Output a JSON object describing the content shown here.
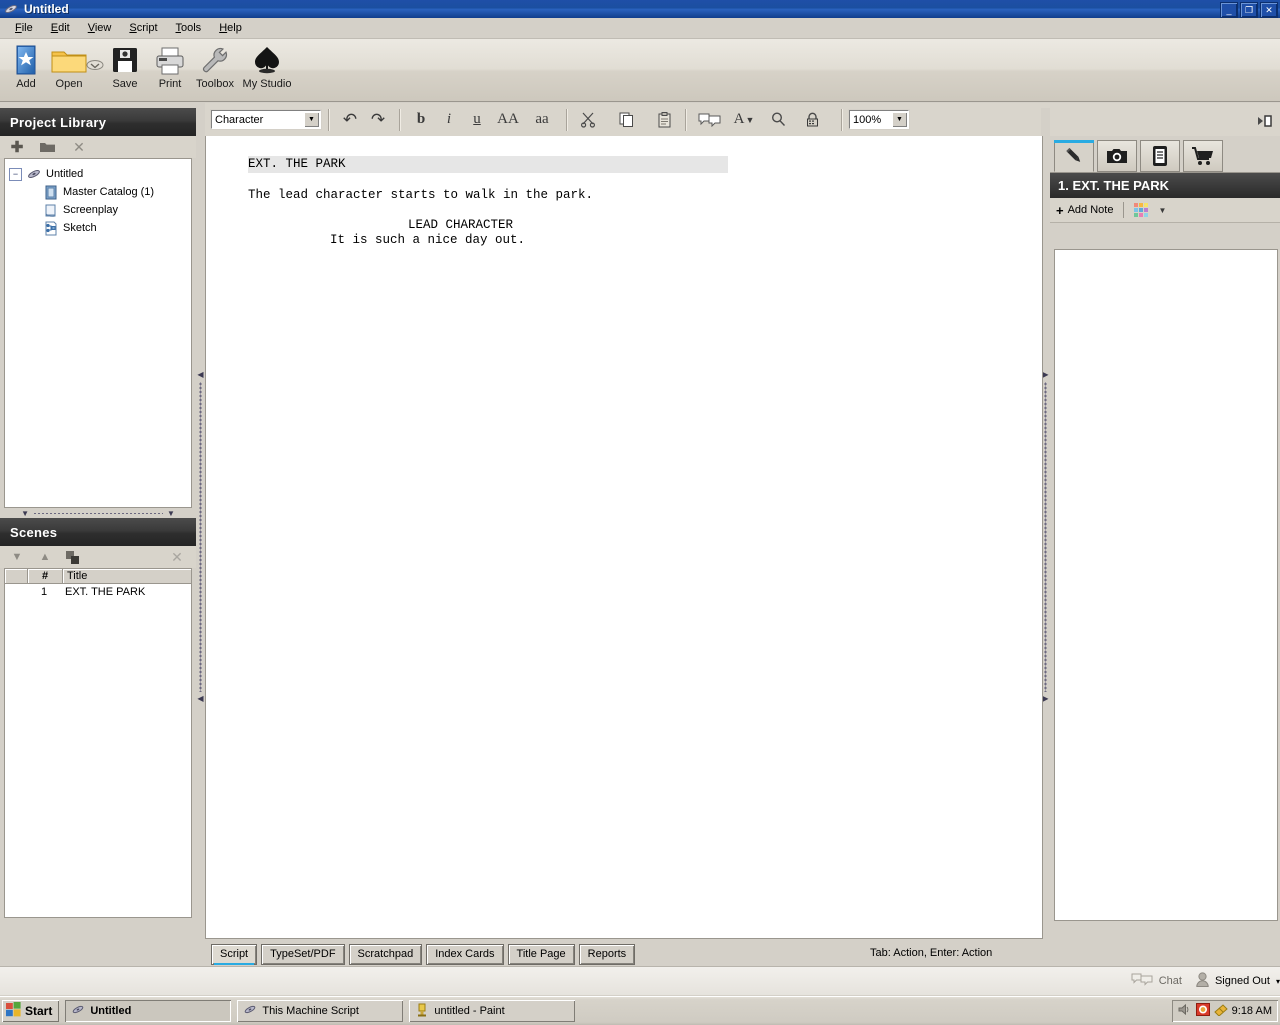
{
  "window": {
    "title": "Untitled",
    "icon": "app-logo-icon",
    "buttons": {
      "minimize": "_",
      "restore": "❐",
      "close": "✕"
    }
  },
  "menubar": [
    {
      "name": "file",
      "label": "File",
      "accel": "F"
    },
    {
      "name": "edit",
      "label": "Edit",
      "accel": "E"
    },
    {
      "name": "view",
      "label": "View",
      "accel": "V"
    },
    {
      "name": "script",
      "label": "Script",
      "accel": "S"
    },
    {
      "name": "tools",
      "label": "Tools",
      "accel": "T"
    },
    {
      "name": "help",
      "label": "Help",
      "accel": "H"
    }
  ],
  "maintoolbar": [
    {
      "name": "add",
      "label": "Add",
      "icon": "star-card-icon"
    },
    {
      "name": "open",
      "label": "Open",
      "icon": "folder-icon"
    },
    {
      "name": "save",
      "label": "Save",
      "icon": "floppy-disk-icon"
    },
    {
      "name": "print",
      "label": "Print",
      "icon": "printer-icon"
    },
    {
      "name": "toolbox",
      "label": "Toolbox",
      "icon": "wrench-icon"
    },
    {
      "name": "my-studio",
      "label": "My Studio",
      "icon": "spade-studio-icon"
    }
  ],
  "formatbar": {
    "element_select": {
      "value": "Character",
      "placeholder": "Character"
    },
    "zoom_select": {
      "value": "100%"
    },
    "buttons": [
      {
        "name": "undo",
        "glyph": "↶",
        "icon": "undo-icon"
      },
      {
        "name": "redo",
        "glyph": "↷",
        "icon": "redo-icon"
      },
      {
        "name": "bold",
        "glyph": "b",
        "icon": "bold-icon"
      },
      {
        "name": "italic",
        "glyph": "i",
        "icon": "italic-icon"
      },
      {
        "name": "underline",
        "glyph": "u",
        "icon": "underline-icon"
      },
      {
        "name": "uppercase",
        "glyph": "AA",
        "icon": "uppercase-icon"
      },
      {
        "name": "lowercase",
        "glyph": "aa",
        "icon": "lowercase-icon"
      },
      {
        "name": "cut",
        "glyph": "✂",
        "icon": "scissors-icon"
      },
      {
        "name": "copy",
        "glyph": "❐",
        "icon": "copy-icon"
      },
      {
        "name": "paste",
        "glyph": "📋",
        "icon": "clipboard-icon"
      },
      {
        "name": "notes",
        "glyph": "🗨",
        "icon": "speech-bubbles-icon"
      },
      {
        "name": "font",
        "glyph": "A",
        "icon": "font-dropdown-icon"
      },
      {
        "name": "find",
        "glyph": "🔍",
        "icon": "magnifier-icon"
      },
      {
        "name": "lock",
        "glyph": "🔒",
        "icon": "padlock-icon"
      }
    ],
    "collapse_icon": "collapse-right-panel-icon"
  },
  "project_library": {
    "title": "Project Library",
    "toolbar": [
      {
        "name": "add-item",
        "glyph": "✚",
        "icon": "plus-icon"
      },
      {
        "name": "new-folder",
        "glyph": "▰",
        "icon": "folder-icon"
      },
      {
        "name": "delete-item",
        "glyph": "✕",
        "icon": "close-icon"
      }
    ],
    "tree": [
      {
        "name": "untitled",
        "label": "Untitled",
        "icon": "app-logo-icon",
        "depth": 0,
        "expander": "−"
      },
      {
        "name": "master-catalog",
        "label": "Master Catalog (1)",
        "icon": "book-icon",
        "depth": 1
      },
      {
        "name": "screenplay",
        "label": "Screenplay",
        "icon": "script-scroll-icon",
        "depth": 1
      },
      {
        "name": "sketch",
        "label": "Sketch",
        "icon": "sketch-node-icon",
        "depth": 1
      }
    ]
  },
  "scenes": {
    "title": "Scenes",
    "toolbar": [
      {
        "name": "move-down",
        "glyph": "▼",
        "icon": "chevron-down-icon"
      },
      {
        "name": "move-up",
        "glyph": "▲",
        "icon": "chevron-up-icon"
      },
      {
        "name": "duplicate",
        "glyph": "▣",
        "icon": "duplicate-icon"
      },
      {
        "name": "delete",
        "glyph": "✕",
        "icon": "close-icon"
      }
    ],
    "columns": [
      "",
      "#",
      "Title"
    ],
    "rows": [
      {
        "num": "1",
        "title": "EXT. THE PARK"
      }
    ]
  },
  "editor": {
    "lines": [
      {
        "name": "scene-heading",
        "type": "slug",
        "text": "EXT. THE PARK"
      },
      {
        "name": "action-line",
        "type": "action",
        "text": "The lead character starts to walk in the park."
      },
      {
        "name": "character-cue",
        "type": "character",
        "text": "LEAD CHARACTER"
      },
      {
        "name": "dialogue-line",
        "type": "dialog",
        "text": "It is such a nice day out."
      }
    ]
  },
  "notes_panel": {
    "tabs": [
      {
        "name": "notes",
        "glyph": "✏",
        "icon": "pencil-icon",
        "active": true
      },
      {
        "name": "photos",
        "glyph": "📷",
        "icon": "camera-icon",
        "active": false
      },
      {
        "name": "research",
        "glyph": "📋",
        "icon": "document-icon",
        "active": false
      },
      {
        "name": "store",
        "glyph": "🛒",
        "icon": "cart-icon",
        "active": false
      }
    ],
    "header": "1. EXT. THE PARK",
    "add_note_label": "Add Note",
    "add_note_icon": "plus-icon",
    "color_picker_icon": "color-swatch-icon",
    "color_dropdown_icon": "chevron-down-icon",
    "swatch_colors": [
      "#f08a7a",
      "#f5b942",
      "#f7e36a",
      "#7ac4e8",
      "#5fa8d8",
      "#bb7ed0",
      "#6fc79a",
      "#e87fb5",
      "#8fd4e8"
    ]
  },
  "bottom_tabs": [
    {
      "name": "script",
      "label": "Script",
      "active": true
    },
    {
      "name": "typeset-pdf",
      "label": "TypeSet/PDF",
      "active": false
    },
    {
      "name": "scratchpad",
      "label": "Scratchpad",
      "active": false
    },
    {
      "name": "index-cards",
      "label": "Index Cards",
      "active": false
    },
    {
      "name": "title-page",
      "label": "Title Page",
      "active": false
    },
    {
      "name": "reports",
      "label": "Reports",
      "active": false
    }
  ],
  "status": {
    "hint": "Tab: Action, Enter: Action",
    "chat_label": "Chat",
    "chat_icon": "speech-bubbles-icon",
    "account_label": "Signed Out",
    "account_icon": "user-icon",
    "account_caret": "▾"
  },
  "taskbar": {
    "start_label": "Start",
    "start_icon": "windows-flag-icon",
    "items": [
      {
        "name": "taskbar-item-untitled",
        "label": "Untitled",
        "icon": "app-logo-icon",
        "active": true
      },
      {
        "name": "taskbar-item-machine",
        "label": "This Machine Script",
        "icon": "app-logo-icon",
        "active": false
      },
      {
        "name": "taskbar-item-paint",
        "label": "untitled - Paint",
        "icon": "paint-icon",
        "active": false
      }
    ],
    "tray": {
      "icons": [
        {
          "name": "volume-icon",
          "glyph": "🔊"
        },
        {
          "name": "recording-icon",
          "glyph": "⏺"
        },
        {
          "name": "network-icon",
          "glyph": "📶"
        }
      ],
      "clock": "9:18 AM"
    }
  },
  "colors": {
    "accent": "#29abe2",
    "title_bar": "#1f4fa8",
    "panel_header": "#2e2e2e",
    "chrome": "#d4d0c8"
  }
}
